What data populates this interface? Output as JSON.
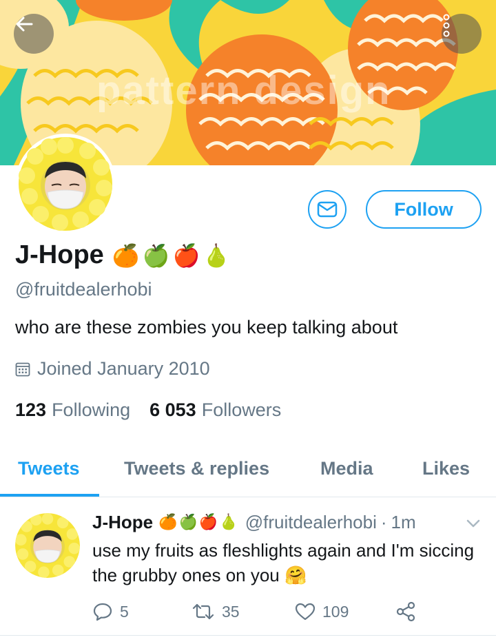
{
  "header": {
    "watermark": "pattern design",
    "back_icon": "arrow-left-icon",
    "more_icon": "more-vertical-icon"
  },
  "profile": {
    "display_name": "J-Hope",
    "name_emoji": "🍊🍏🍎🍐",
    "handle": "@fruitdealerhobi",
    "bio": "who are these zombies you keep talking about",
    "joined": "Joined January 2010",
    "following_count": "123",
    "following_label": "Following",
    "followers_count": "6 053",
    "followers_label": "Followers"
  },
  "actions": {
    "follow_label": "Follow",
    "message_icon": "envelope-icon"
  },
  "tabs": [
    {
      "label": "Tweets",
      "active": true
    },
    {
      "label": "Tweets & replies",
      "active": false
    },
    {
      "label": "Media",
      "active": false
    },
    {
      "label": "Likes",
      "active": false
    }
  ],
  "tweet": {
    "name": "J-Hope",
    "name_emoji": "🍊🍏🍎🍐",
    "handle": "@fruitdealerhobi",
    "separator": "·",
    "time": "1m",
    "text": "use my fruits as fleshlights again and I'm siccing the grubby ones on you 🤗",
    "replies": "5",
    "retweets": "35",
    "likes": "109"
  },
  "colors": {
    "accent": "#1da1f2",
    "secondary_text": "#657786",
    "banner_yellow": "#f7c91e",
    "banner_orange": "#f5822a",
    "banner_teal": "#2ec4a6"
  }
}
